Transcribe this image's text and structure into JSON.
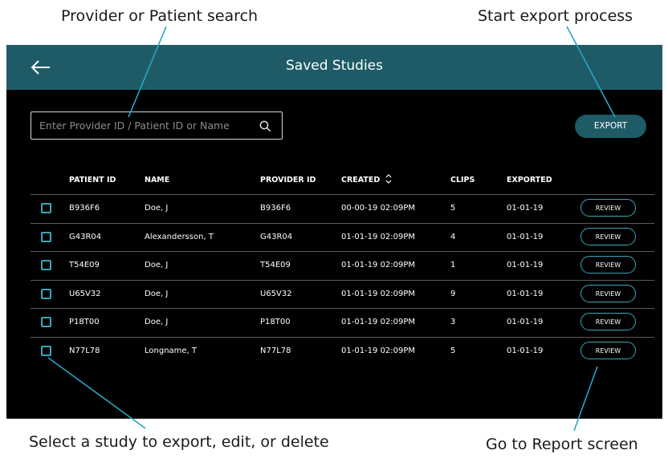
{
  "annotations": {
    "search": "Provider or Patient search",
    "export": "Start export process",
    "select": "Select a study to export, edit, or delete",
    "review": "Go to Report screen"
  },
  "header": {
    "title": "Saved Studies",
    "back_icon": "arrow-left-icon"
  },
  "search": {
    "placeholder": "Enter Provider ID / Patient ID or Name",
    "value": "",
    "icon": "search-icon"
  },
  "export_button": {
    "label": "EXPORT"
  },
  "table": {
    "columns": {
      "patient_id": "PATIENT ID",
      "name": "NAME",
      "provider_id": "PROVIDER ID",
      "created": "CREATED",
      "clips": "CLIPS",
      "exported": "EXPORTED"
    },
    "rows": [
      {
        "patient_id": "B936F6",
        "name": "Doe, J",
        "provider_id": "B936F6",
        "created": "00-00-19  02:09PM",
        "clips": "5",
        "exported": "01-01-19",
        "action": "REVIEW"
      },
      {
        "patient_id": "G43R04",
        "name": "Alexandersson, T",
        "provider_id": "G43R04",
        "created": "01-01-19  02:09PM",
        "clips": "4",
        "exported": "01-01-19",
        "action": "REVIEW"
      },
      {
        "patient_id": "T54E09",
        "name": "Doe, J",
        "provider_id": "T54E09",
        "created": "01-01-19  02:09PM",
        "clips": "1",
        "exported": "01-01-19",
        "action": "REVIEW"
      },
      {
        "patient_id": "U65V32",
        "name": "Doe, J",
        "provider_id": "U65V32",
        "created": "01-01-19  02:09PM",
        "clips": "9",
        "exported": "01-01-19",
        "action": "REVIEW"
      },
      {
        "patient_id": "P18T00",
        "name": "Doe, J",
        "provider_id": "P18T00",
        "created": "01-01-19  02:09PM",
        "clips": "3",
        "exported": "01-01-19",
        "action": "REVIEW"
      },
      {
        "patient_id": "N77L78",
        "name": "Longname, T",
        "provider_id": "N77L78",
        "created": "01-01-19  02:09PM",
        "clips": "5",
        "exported": "01-01-19",
        "action": "REVIEW"
      }
    ]
  },
  "colors": {
    "header_bg": "#1e5b66",
    "accent": "#3aa6ba",
    "screen_bg": "#000000",
    "callout_line": "#2aa3c8"
  }
}
